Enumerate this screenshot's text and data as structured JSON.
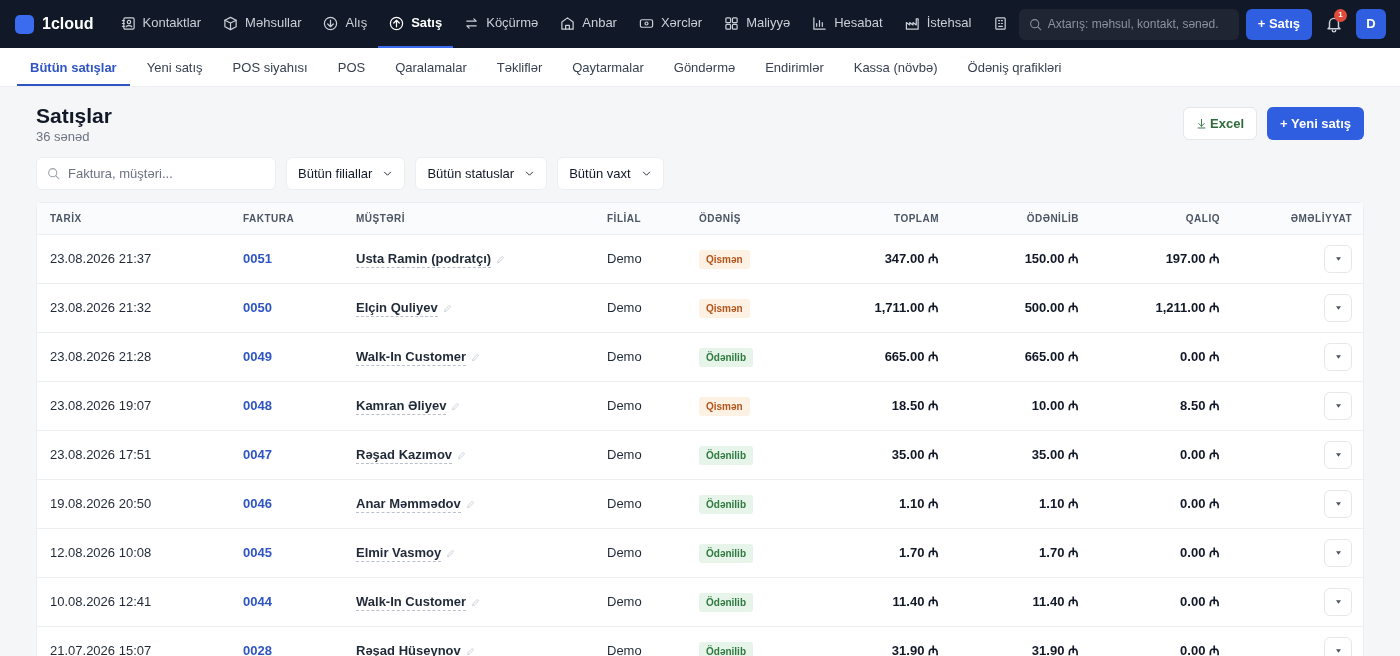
{
  "brand": "1cloud",
  "nav": [
    {
      "label": "Kontaktlar",
      "selected": false
    },
    {
      "label": "Məhsullar",
      "selected": false
    },
    {
      "label": "Alış",
      "selected": false
    },
    {
      "label": "Satış",
      "selected": true
    },
    {
      "label": "Köçürmə",
      "selected": false
    },
    {
      "label": "Anbar",
      "selected": false
    },
    {
      "label": "Xərclər",
      "selected": false
    },
    {
      "label": "Maliyyə",
      "selected": false
    },
    {
      "label": "Hesabat",
      "selected": false
    },
    {
      "label": "İstehsal",
      "selected": false
    },
    {
      "selected": false
    }
  ],
  "search": {
    "placeholder": "Axtarış: məhsul, kontakt, sənəd."
  },
  "new_sale_button": "+ Satış",
  "notifications": "1",
  "avatar": "D",
  "subnav": [
    {
      "label": "Bütün satışlar",
      "selected": true
    },
    {
      "label": "Yeni satış",
      "selected": false
    },
    {
      "label": "POS siyahısı",
      "selected": false
    },
    {
      "label": "POS",
      "selected": false
    },
    {
      "label": "Qaralamalar",
      "selected": false
    },
    {
      "label": "Təkliflər",
      "selected": false
    },
    {
      "label": "Qaytarmalar",
      "selected": false
    },
    {
      "label": "Göndərmə",
      "selected": false
    },
    {
      "label": "Endirimlər",
      "selected": false
    },
    {
      "label": "Kassa (növbə)",
      "selected": false
    },
    {
      "label": "Ödəniş qrafikləri",
      "selected": false
    }
  ],
  "title": "Satışlar",
  "subtitle": "36 sənəd",
  "actions": {
    "excel": "Excel",
    "new": "+ Yeni satış"
  },
  "filters": {
    "search_placeholder": "Faktura, müştəri...",
    "dropdowns": [
      "Bütün filiallar",
      "Bütün statuslar",
      "Bütün vaxt"
    ]
  },
  "table": {
    "columns": [
      "TARİX",
      "FAKTURA",
      "MÜŞTƏRİ",
      "FİLİAL",
      "ÖDƏNİŞ",
      "TOPLAM",
      "ÖDƏNİLİB",
      "QALIQ",
      "ƏMƏLİYYAT"
    ],
    "rows": [
      {
        "date": "23.08.2026 21:37",
        "invoice": "0051",
        "customer": "Usta Ramin (podratçı)",
        "branch": "Demo",
        "payment": {
          "label": "Qismən",
          "kind": "partial"
        },
        "total": "347.00 ₼",
        "paid": "150.00 ₼",
        "balance": "197.00 ₼"
      },
      {
        "date": "23.08.2026 21:32",
        "invoice": "0050",
        "customer": "Elçin Quliyev",
        "branch": "Demo",
        "payment": {
          "label": "Qismən",
          "kind": "partial"
        },
        "total": "1,711.00 ₼",
        "paid": "500.00 ₼",
        "balance": "1,211.00 ₼"
      },
      {
        "date": "23.08.2026 21:28",
        "invoice": "0049",
        "customer": "Walk-In Customer",
        "branch": "Demo",
        "payment": {
          "label": "Ödənilib",
          "kind": "paid"
        },
        "total": "665.00 ₼",
        "paid": "665.00 ₼",
        "balance": "0.00 ₼"
      },
      {
        "date": "23.08.2026 19:07",
        "invoice": "0048",
        "customer": "Kamran Əliyev",
        "branch": "Demo",
        "payment": {
          "label": "Qismən",
          "kind": "partial"
        },
        "total": "18.50 ₼",
        "paid": "10.00 ₼",
        "balance": "8.50 ₼"
      },
      {
        "date": "23.08.2026 17:51",
        "invoice": "0047",
        "customer": "Rəşad Kazımov",
        "branch": "Demo",
        "payment": {
          "label": "Ödənilib",
          "kind": "paid"
        },
        "total": "35.00 ₼",
        "paid": "35.00 ₼",
        "balance": "0.00 ₼"
      },
      {
        "date": "19.08.2026 20:50",
        "invoice": "0046",
        "customer": "Anar Məmmədov",
        "branch": "Demo",
        "payment": {
          "label": "Ödənilib",
          "kind": "paid"
        },
        "total": "1.10 ₼",
        "paid": "1.10 ₼",
        "balance": "0.00 ₼"
      },
      {
        "date": "12.08.2026 10:08",
        "invoice": "0045",
        "customer": "Elmir Vasmoy",
        "branch": "Demo",
        "payment": {
          "label": "Ödənilib",
          "kind": "paid"
        },
        "total": "1.70 ₼",
        "paid": "1.70 ₼",
        "balance": "0.00 ₼"
      },
      {
        "date": "10.08.2026 12:41",
        "invoice": "0044",
        "customer": "Walk-In Customer",
        "branch": "Demo",
        "payment": {
          "label": "Ödənilib",
          "kind": "paid"
        },
        "total": "11.40 ₼",
        "paid": "11.40 ₼",
        "balance": "0.00 ₼"
      },
      {
        "date": "21.07.2026 15:07",
        "invoice": "0028",
        "customer": "Rəşad Hüseynov",
        "branch": "Demo",
        "payment": {
          "label": "Ödənilib",
          "kind": "paid"
        },
        "total": "31.90 ₼",
        "paid": "31.90 ₼",
        "balance": "0.00 ₼"
      }
    ]
  }
}
